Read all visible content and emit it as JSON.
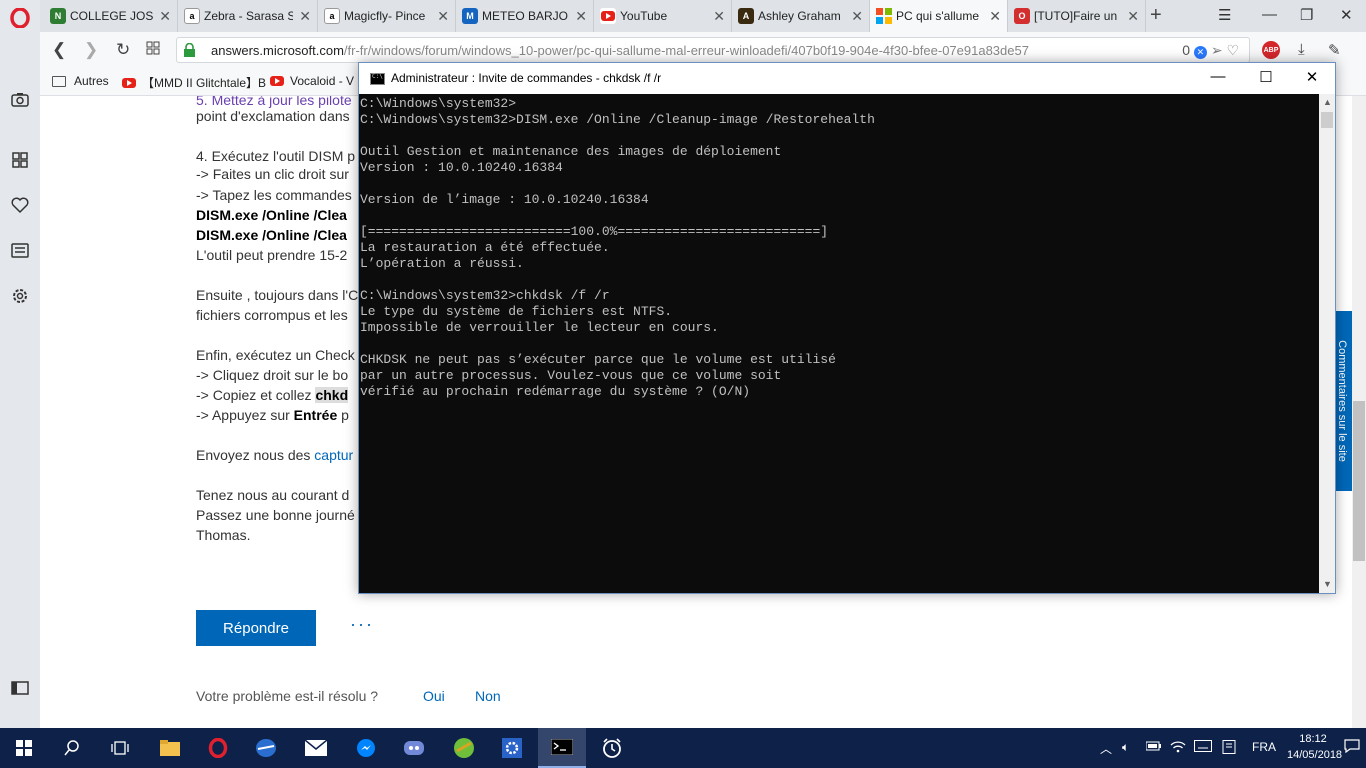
{
  "browser": {
    "tabs": [
      {
        "label": "COLLEGE JOSEPH",
        "favicon": "college-icon",
        "color": "#2e7d32"
      },
      {
        "label": "Zebra - Sarasa S",
        "favicon": "amazon-icon",
        "color": "#232f3e"
      },
      {
        "label": "Magicfly- Pince",
        "favicon": "amazon-icon",
        "color": "#232f3e"
      },
      {
        "label": "METEO BARJOLS",
        "favicon": "meteo-icon",
        "color": "#1565c0"
      },
      {
        "label": "YouTube",
        "favicon": "youtube-icon",
        "color": "#e62117"
      },
      {
        "label": "Ashley Graham",
        "favicon": "ashley-icon",
        "color": "#3a2b10"
      },
      {
        "label": "PC qui s'allume",
        "favicon": "microsoft-icon",
        "color": "#f25022"
      },
      {
        "label": "[TUTO]Faire un",
        "favicon": "tuto-icon",
        "color": "#d32f2f"
      }
    ],
    "url": {
      "domain": "answers.microsoft.com",
      "path": "/fr-fr/windows/forum/windows_10-power/pc-qui-sallume-mal-erreur-winloadefi/407b0f19-904e-4f30-bfee-07e91a83de57"
    },
    "url_badge": "0",
    "abp": "ABP",
    "bookmarks": [
      "Autres",
      "【MMD II Glitchtale】B",
      "Vocaloid - V"
    ]
  },
  "page": {
    "lines": {
      "l1a": "5. Mettez à jour les pilote",
      "l1b": "point d'exclamation dans",
      "l2": "4. Exécutez l'outil DISM p",
      "l3": "-> Faites un clic droit sur",
      "l4": "-> Tapez les commandes",
      "l5": "DISM.exe /Online /Clea",
      "l6": "DISM.exe /Online /Clea",
      "l7": "L'outil peut prendre 15-2",
      "l8": "Ensuite , toujours dans l'C",
      "l9": "fichiers corrompus et les",
      "l10": "Enfin, exécutez un Check",
      "l11": "-> Cliquez droit sur le bo",
      "l12a": "-> Copiez et collez ",
      "l12b": "chkd",
      "l13a": "-> Appuyez sur ",
      "l13b": "Entrée",
      "l13c": " p",
      "l14a": "Envoyez nous des ",
      "l14b": "captur",
      "l15": "Tenez nous au courant d",
      "l16": "Passez une bonne journé",
      "l17": "Thomas."
    },
    "reply_button": "Répondre",
    "more": "···",
    "resolved_question": "Votre problème est-il résolu ?",
    "yes": "Oui",
    "no": "Non",
    "feedback": "Commentaires sur le site"
  },
  "cmd": {
    "title": "Administrateur : Invite de commandes - chkdsk  /f /r",
    "output": "C:\\Windows\\system32>\nC:\\Windows\\system32>DISM.exe /Online /Cleanup-image /Restorehealth\n\nOutil Gestion et maintenance des images de déploiement\nVersion : 10.0.10240.16384\n\nVersion de l’image : 10.0.10240.16384\n\n[==========================100.0%==========================]\nLa restauration a été effectuée.\nL’opération a réussi.\n\nC:\\Windows\\system32>chkdsk /f /r\nLe type du système de fichiers est NTFS.\nImpossible de verrouiller le lecteur en cours.\n\nCHKDSK ne peut pas s’exécuter parce que le volume est utilisé\npar un autre processus. Voulez-vous que ce volume soit\nvérifié au prochain redémarrage du système ? (O/N)"
  },
  "taskbar": {
    "language": "FRA",
    "time": "18:12",
    "date": "14/05/2018"
  }
}
